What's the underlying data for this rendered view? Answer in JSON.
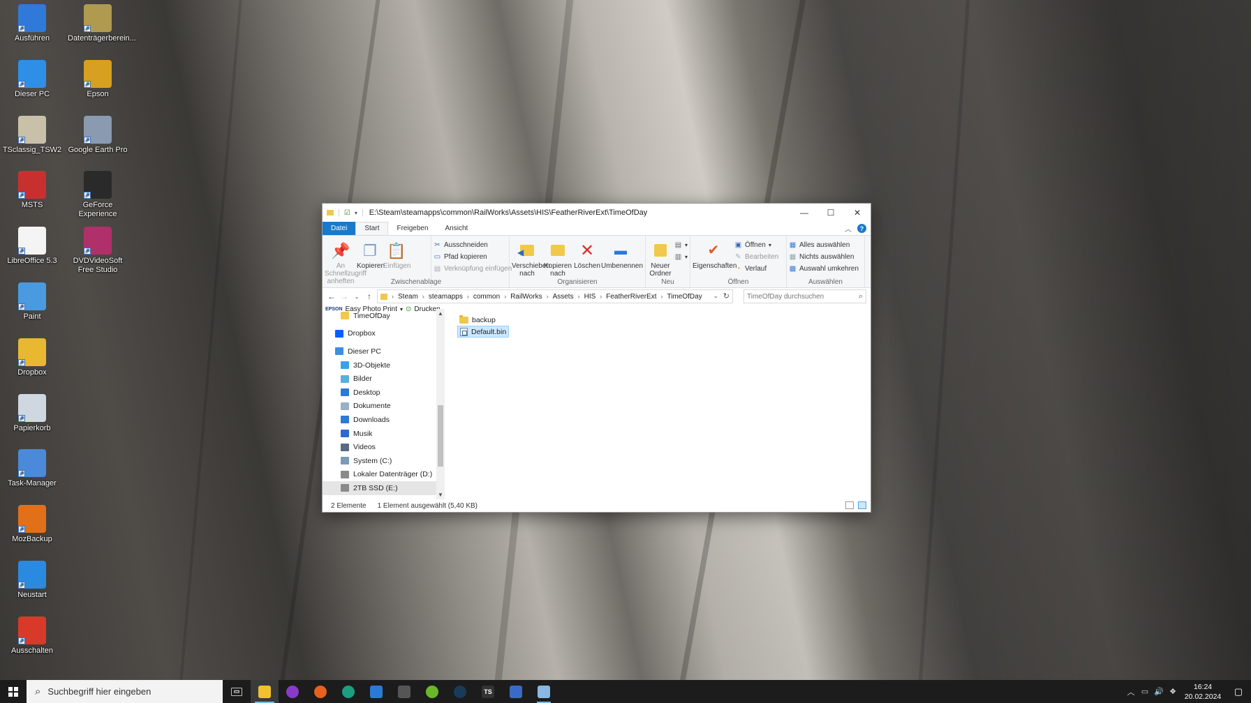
{
  "desktop": {
    "icons": [
      {
        "label": "Ausführen",
        "icon": "run-icon",
        "color": "#2f7ad8"
      },
      {
        "label": "Datenträgerberein...",
        "icon": "disk-cleanup-icon",
        "color": "#b09a50"
      },
      {
        "label": "Dieser PC",
        "icon": "computer-icon",
        "color": "#2f8fe6"
      },
      {
        "label": "Epson",
        "icon": "epson-icon",
        "color": "#d8a020"
      },
      {
        "label": "TSclassig_TSW2",
        "icon": "ts-icon",
        "color": "#c8c0a8"
      },
      {
        "label": "Google Earth Pro",
        "icon": "google-earth-icon",
        "color": "#8a9ab0"
      },
      {
        "label": "MSTS",
        "icon": "msts-icon",
        "color": "#c83030"
      },
      {
        "label": "GeForce Experience",
        "icon": "geforce-icon",
        "color": "#2a2a2a"
      },
      {
        "label": "LibreOffice 5.3",
        "icon": "document-icon",
        "color": "#f4f4f4"
      },
      {
        "label": "DVDVideoSoft Free Studio",
        "icon": "fs-icon",
        "color": "#b0306a"
      },
      {
        "label": "Paint",
        "icon": "paint-icon",
        "color": "#4a9ae0"
      },
      {
        "label": "Dropbox",
        "icon": "dropbox-folder-icon",
        "color": "#e8b830"
      },
      {
        "label": "Papierkorb",
        "icon": "recycle-bin-icon",
        "color": "#cfd8e0"
      },
      {
        "label": "Task-Manager",
        "icon": "task-manager-icon",
        "color": "#4a8ad8"
      },
      {
        "label": "MozBackup",
        "icon": "mozbackup-icon",
        "color": "#e0701a"
      },
      {
        "label": "Neustart",
        "icon": "restart-icon",
        "color": "#2a8ae0"
      },
      {
        "label": "Ausschalten",
        "icon": "power-icon",
        "color": "#d83a2a"
      }
    ]
  },
  "window": {
    "title": "E:\\Steam\\steamapps\\common\\RailWorks\\Assets\\HIS\\FeatherRiverExt\\TimeOfDay",
    "controls": {
      "minimize": "—",
      "maximize": "☐",
      "close": "✕"
    },
    "tabs": {
      "file": "Datei",
      "start": "Start",
      "share": "Freigeben",
      "view": "Ansicht"
    },
    "ribbon": {
      "clipboard": {
        "label": "Zwischenablage",
        "pin": "An Schnellzugriff anheften",
        "copy": "Kopieren",
        "paste": "Einfügen",
        "cut": "Ausschneiden",
        "copy_path": "Pfad kopieren",
        "paste_shortcut": "Verknüpfung einfügen"
      },
      "organize": {
        "label": "Organisieren",
        "move_to": "Verschieben nach",
        "copy_to": "Kopieren nach",
        "delete": "Löschen",
        "rename": "Umbenennen"
      },
      "new": {
        "label": "Neu",
        "new_folder": "Neuer Ordner"
      },
      "open": {
        "label": "Öffnen",
        "properties": "Eigenschaften",
        "open": "Öffnen",
        "edit": "Bearbeiten",
        "history": "Verlauf"
      },
      "select": {
        "label": "Auswählen",
        "select_all": "Alles auswählen",
        "select_none": "Nichts auswählen",
        "invert": "Auswahl umkehren"
      }
    },
    "address": {
      "crumbs": [
        "Steam",
        "steamapps",
        "common",
        "RailWorks",
        "Assets",
        "HIS",
        "FeatherRiverExt",
        "TimeOfDay"
      ],
      "search_placeholder": "TimeOfDay durchsuchen"
    },
    "favbar": {
      "epson": "EPSON",
      "easy_print": "Easy Photo Print",
      "print": "Drucken"
    },
    "nav": [
      {
        "label": "TimeOfDay",
        "indent": 2,
        "icon": "folder-icon",
        "color": "#f0c94a"
      },
      {
        "label": "",
        "indent": 0,
        "icon": "",
        "color": ""
      },
      {
        "label": "Dropbox",
        "indent": 1,
        "icon": "dropbox-icon",
        "color": "#0061fe"
      },
      {
        "label": "",
        "indent": 0,
        "icon": "",
        "color": ""
      },
      {
        "label": "Dieser PC",
        "indent": 1,
        "icon": "computer-icon",
        "color": "#3a8ee6"
      },
      {
        "label": "3D-Objekte",
        "indent": 2,
        "icon": "3d-objects-icon",
        "color": "#3aa0e8"
      },
      {
        "label": "Bilder",
        "indent": 2,
        "icon": "pictures-icon",
        "color": "#5ab0e0"
      },
      {
        "label": "Desktop",
        "indent": 2,
        "icon": "desktop-icon",
        "color": "#2a7ad8"
      },
      {
        "label": "Dokumente",
        "indent": 2,
        "icon": "documents-icon",
        "color": "#9ab0c8"
      },
      {
        "label": "Downloads",
        "indent": 2,
        "icon": "downloads-icon",
        "color": "#2a7ad8"
      },
      {
        "label": "Musik",
        "indent": 2,
        "icon": "music-icon",
        "color": "#2a6ad0"
      },
      {
        "label": "Videos",
        "indent": 2,
        "icon": "videos-icon",
        "color": "#5a6a80"
      },
      {
        "label": "System (C:)",
        "indent": 2,
        "icon": "drive-system-icon",
        "color": "#7a9ab8"
      },
      {
        "label": "Lokaler Datenträger (D:)",
        "indent": 2,
        "icon": "drive-icon",
        "color": "#8a8a8a"
      },
      {
        "label": "2TB SSD (E:)",
        "indent": 2,
        "icon": "drive-icon",
        "color": "#8a8a8a",
        "selected": true
      }
    ],
    "files": [
      {
        "name": "backup",
        "type": "folder",
        "selected": false
      },
      {
        "name": "Default.bin",
        "type": "file",
        "selected": true
      }
    ],
    "status": {
      "count": "2 Elemente",
      "selection": "1 Element ausgewählt (5,40 KB)"
    }
  },
  "taskbar": {
    "search_placeholder": "Suchbegriff hier eingeben",
    "apps": [
      {
        "name": "task-view-icon",
        "label": "▭",
        "color": "#1c1c1c"
      },
      {
        "name": "file-explorer-icon",
        "label": "",
        "color": "#f0c030",
        "state": "active"
      },
      {
        "name": "mask-app-icon",
        "label": "",
        "color": "#8a3ac8"
      },
      {
        "name": "firefox-icon",
        "label": "",
        "color": "#e8601a"
      },
      {
        "name": "edge-icon",
        "label": "",
        "color": "#1aa080"
      },
      {
        "name": "mail-icon",
        "label": "",
        "color": "#2a7ad8"
      },
      {
        "name": "home-app-icon",
        "label": "",
        "color": "#555"
      },
      {
        "name": "green-app-icon",
        "label": "",
        "color": "#6ab82a"
      },
      {
        "name": "steam-icon",
        "label": "",
        "color": "#1a3a5a"
      },
      {
        "name": "ts-app-icon",
        "label": "TS",
        "color": "#333"
      },
      {
        "name": "train-app-icon",
        "label": "",
        "color": "#3a6ac8"
      },
      {
        "name": "notepad-icon",
        "label": "",
        "color": "#8ab8e0",
        "state": "open"
      }
    ],
    "time": "16:24",
    "date": "20.02.2024"
  }
}
